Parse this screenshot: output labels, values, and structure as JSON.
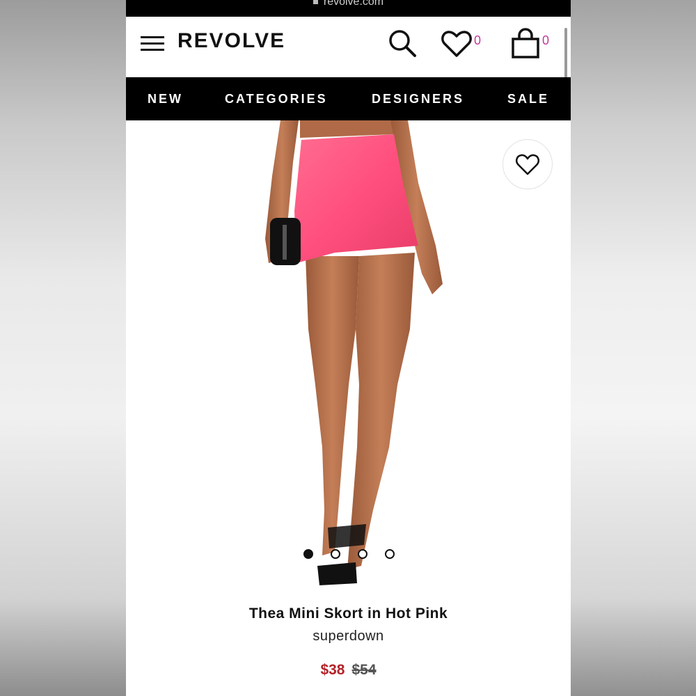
{
  "browser": {
    "url": "revolve.com"
  },
  "header": {
    "brand": "REVOLVE",
    "wishlist_count": "0",
    "bag_count": "0"
  },
  "icons": {
    "menu": "hamburger-menu-icon",
    "search": "search-icon",
    "wishlist": "heart-icon",
    "bag": "shopping-bag-icon",
    "favorite": "heart-outline-icon"
  },
  "nav": {
    "items": [
      "NEW",
      "CATEGORIES",
      "DESIGNERS",
      "SALE"
    ]
  },
  "carousel": {
    "total": 4,
    "active": 1
  },
  "product": {
    "title": "Thea Mini Skort in Hot Pink",
    "designer": "superdown",
    "sale_price": "$38",
    "original_price": "$54"
  },
  "colors": {
    "accent_count": "#c0399b",
    "sale_price": "#b3232a",
    "skirt": "#ff4f7e"
  }
}
